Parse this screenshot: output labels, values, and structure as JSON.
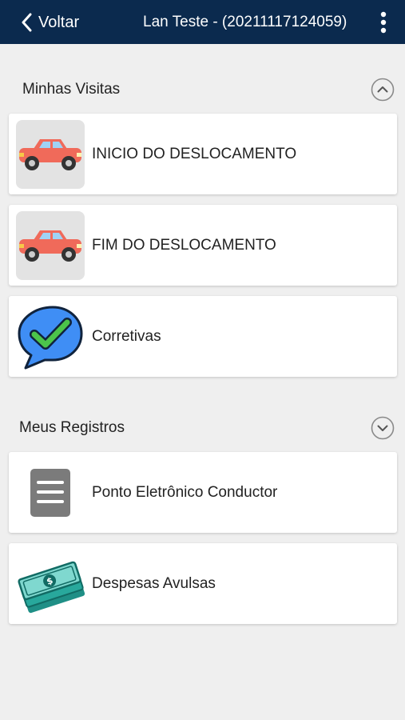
{
  "header": {
    "back_label": "Voltar",
    "title": "Lan Teste - (20211117124059)",
    "background_color": "#0b2a4e",
    "back_icon": "chevron-left-icon",
    "menu_icon": "vertical-dots-icon"
  },
  "sections": {
    "visits": {
      "title": "Minhas Visitas",
      "toggle_icon": "chevron-up-circle-icon",
      "items": [
        {
          "label": "INICIO DO DESLOCAMENTO",
          "icon": "car-icon"
        },
        {
          "label": "FIM DO DESLOCAMENTO",
          "icon": "car-icon"
        },
        {
          "label": "Corretivas",
          "icon": "check-chat-bubble-icon"
        }
      ]
    },
    "records": {
      "title": "Meus Registros",
      "toggle_icon": "chevron-down-circle-icon",
      "items": [
        {
          "label": "Ponto Eletrônico Conductor",
          "icon": "document-icon"
        },
        {
          "label": "Despesas Avulsas",
          "icon": "money-icon"
        }
      ]
    }
  },
  "colors": {
    "car_body": "#f06a5a",
    "check_bubble": "#3f8ef5",
    "check_mark": "#4cc44a",
    "document": "#7b7b7b",
    "money": "#1f8f86"
  }
}
